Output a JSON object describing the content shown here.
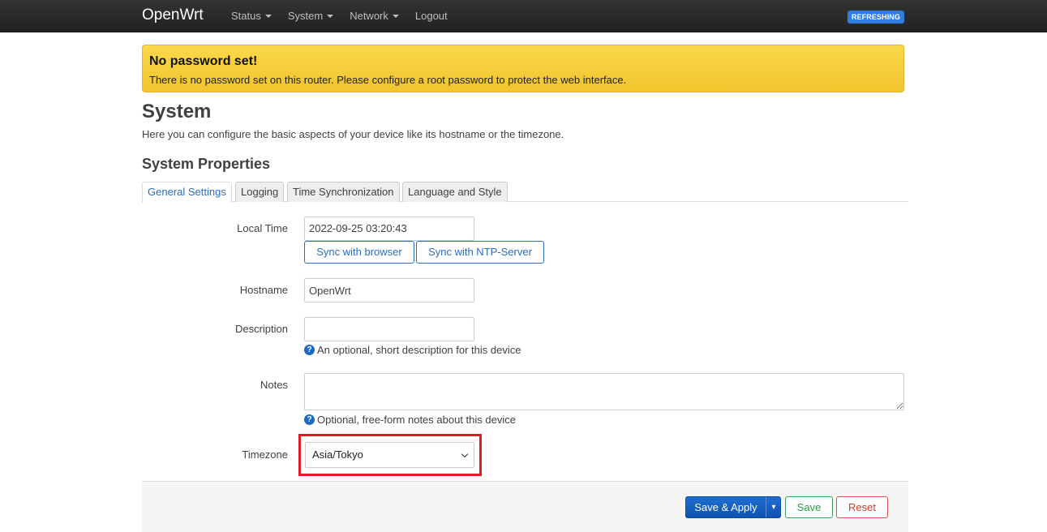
{
  "header": {
    "brand": "OpenWrt",
    "nav": [
      "Status",
      "System",
      "Network",
      "Logout"
    ],
    "badge": "REFRESHING"
  },
  "alert": {
    "title": "No password set!",
    "text": "There is no password set on this router. Please configure a root password to protect the web interface."
  },
  "page": {
    "title": "System",
    "description": "Here you can configure the basic aspects of your device like its hostname or the timezone.",
    "section_title": "System Properties"
  },
  "tabs": [
    "General Settings",
    "Logging",
    "Time Synchronization",
    "Language and Style"
  ],
  "form": {
    "local_time_label": "Local Time",
    "local_time_value": "2022-09-25 03:20:43",
    "sync_browser": "Sync with browser",
    "sync_ntp": "Sync with NTP-Server",
    "hostname_label": "Hostname",
    "hostname_value": "OpenWrt",
    "description_label": "Description",
    "description_value": "",
    "description_hint": "An optional, short description for this device",
    "notes_label": "Notes",
    "notes_value": "",
    "notes_hint": "Optional, free-form notes about this device",
    "timezone_label": "Timezone",
    "timezone_value": "Asia/Tokyo"
  },
  "actions": {
    "save_apply": "Save & Apply",
    "save_apply_arrow": "▾",
    "save": "Save",
    "reset": "Reset"
  },
  "colors": {
    "highlight": "#e11c24",
    "primary": "#1e6fd1",
    "alert_bg": "#f5cf3c"
  }
}
